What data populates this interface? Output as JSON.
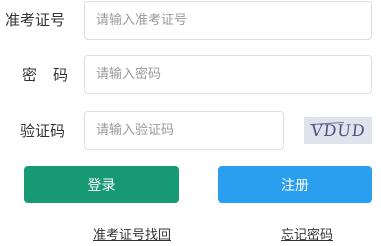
{
  "form": {
    "ticket": {
      "label": "准考证号",
      "placeholder": "请输入准考证号",
      "value": ""
    },
    "password": {
      "label": "密码",
      "placeholder": "请输入密码",
      "value": ""
    },
    "code": {
      "label": "验证码",
      "placeholder": "请输入验证码",
      "value": ""
    },
    "captcha_text": "VDUD"
  },
  "buttons": {
    "login": "登录",
    "register": "注册"
  },
  "links": {
    "find_ticket": "准考证号找回",
    "forgot_password": "忘记密码"
  },
  "colors": {
    "login_button": "#179a74",
    "register_button": "#2a9ff0",
    "captcha_background": "#dfe4ec"
  }
}
